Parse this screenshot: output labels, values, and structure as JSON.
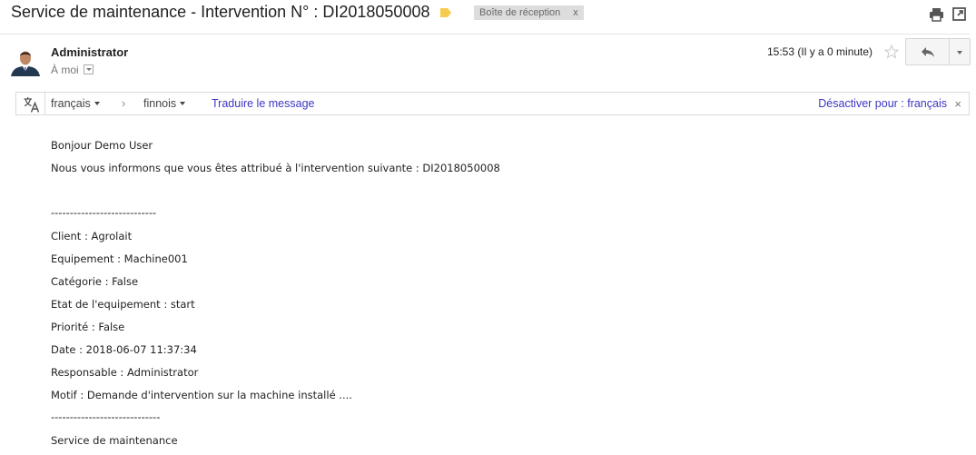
{
  "header": {
    "subject": "Service de maintenance - Intervention N° : DI2018050008",
    "label_chip": "Boîte de réception",
    "label_remove": "x"
  },
  "message": {
    "sender": "Administrator",
    "recipient": "À moi",
    "timestamp": "15:53 (Il y a 0 minute)"
  },
  "translate": {
    "source_lang": "français",
    "arrow": "›",
    "target_lang": "finnois",
    "translate_link": "Traduire le message",
    "disable_link": "Désactiver pour : français",
    "close": "×"
  },
  "body": {
    "greeting": "Bonjour Demo User",
    "intro": "Nous vous informons que vous êtes attribué à l'intervention suivante : DI2018050008",
    "sep1": "----------------------------",
    "client": "Client : Agrolait",
    "equipement": "Equipement : Machine001",
    "categorie": "Catégorie : False",
    "etat": "Etat de l'equipement : start",
    "priorite": "Priorité : False",
    "date": "Date : 2018-06-07 11:37:34",
    "responsable": "Responsable : Administrator",
    "motif": "Motif : Demande d'intervention sur la machine installé ....",
    "sep2": "-----------------------------",
    "signature": "Service de maintenance"
  },
  "icons": {
    "label_tag": "label-tag-icon",
    "print": "print-icon",
    "popout": "popout-icon",
    "star": "star-icon",
    "reply": "reply-icon",
    "translate": "translate-icon"
  },
  "colors": {
    "label_tag": "#f7cb4d",
    "link": "#3b37c0",
    "chip_bg": "#dddddd"
  }
}
